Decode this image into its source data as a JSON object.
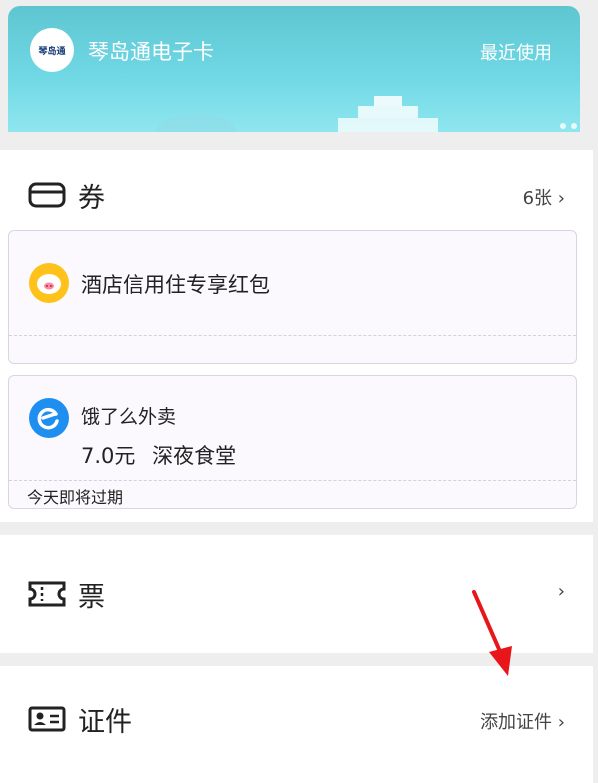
{
  "card": {
    "logo_text": "琴岛通",
    "title": "琴岛通电子卡",
    "recent": "最近使用",
    "gradient_top": "#5ec6d1",
    "gradient_bottom": "#8fe6ef"
  },
  "coupons_section": {
    "label": "券",
    "count": "6张",
    "chevron": "›",
    "items": [
      {
        "title": "酒店信用住专享红包",
        "icon": "fliggy-pig-icon",
        "badge_color": "#ffc21b"
      },
      {
        "title": "饿了么外卖",
        "amount": "7.0元",
        "name": "深夜食堂",
        "note": "今天即将过期",
        "icon": "eleme-icon",
        "badge_color": "#1e8ef0"
      }
    ]
  },
  "tickets_section": {
    "label": "票",
    "chevron": "›"
  },
  "id_section": {
    "label": "证件",
    "action": "添加证件",
    "chevron": "›"
  },
  "annotation": {
    "arrow_color": "#e8161b"
  }
}
